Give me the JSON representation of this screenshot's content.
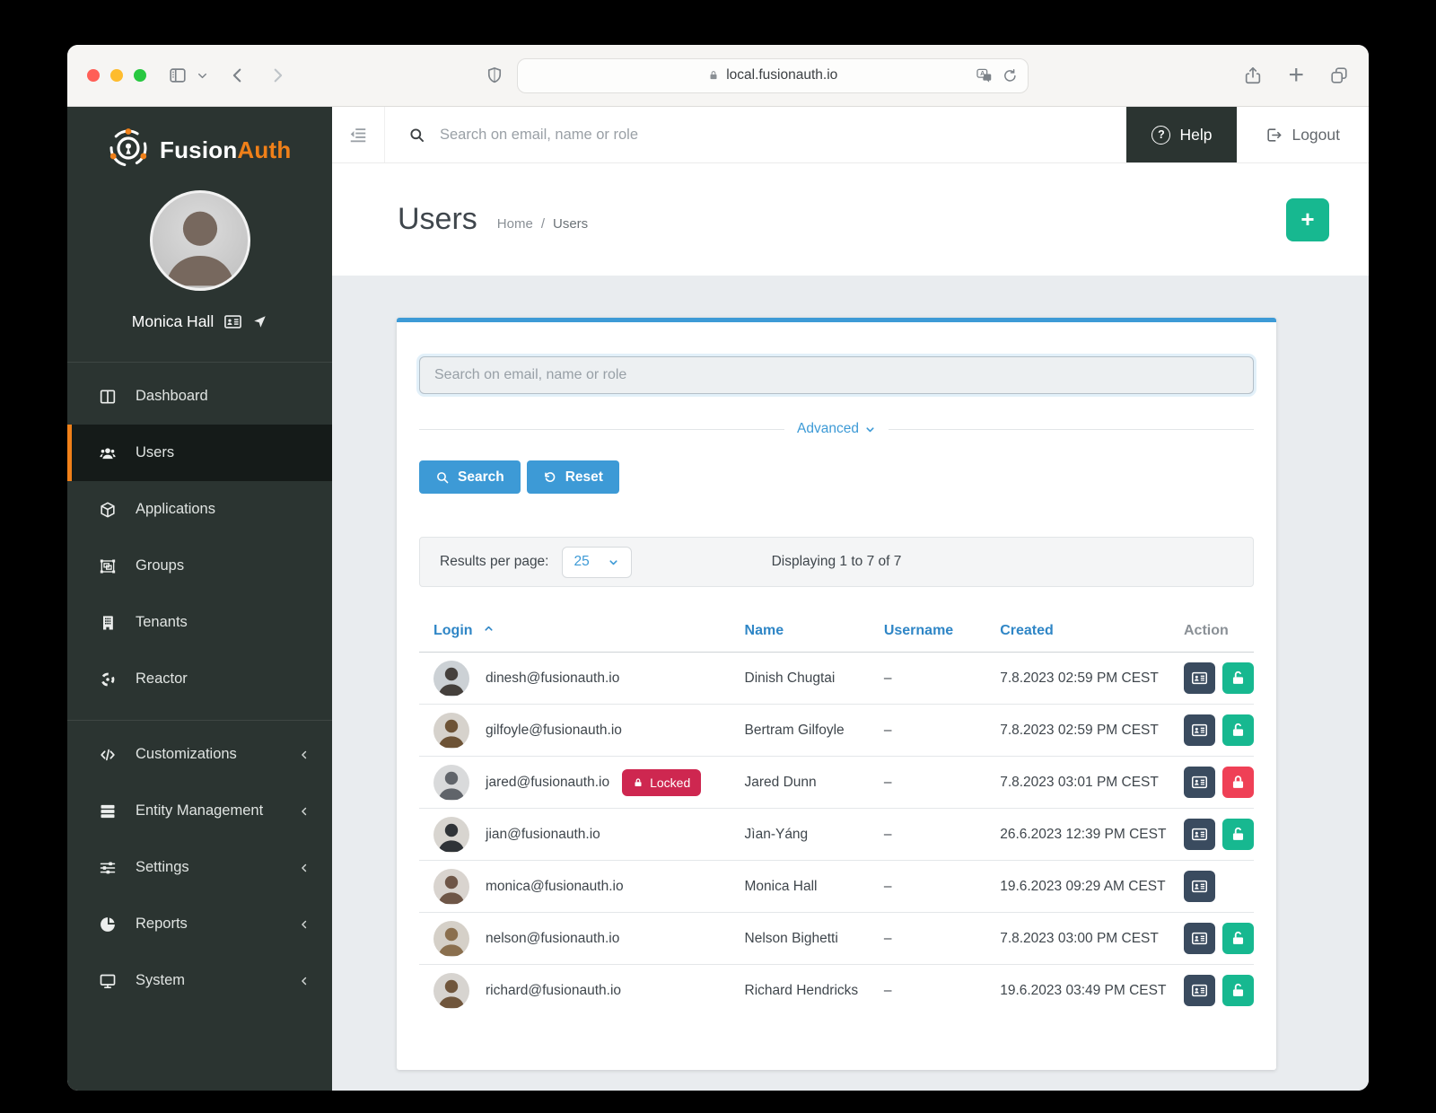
{
  "colors": {
    "blue": "#3d9ad6",
    "link_blue": "#2f86c6",
    "green": "#17b890",
    "orange": "#f08019",
    "red": "#ef4056",
    "badge_red": "#ce2750",
    "dark_action": "#3a4b5f",
    "side_bg": "#2b3431"
  },
  "browser": {
    "url": "local.fusionauth.io"
  },
  "sidebar": {
    "brand": {
      "name_primary": "Fusion",
      "name_secondary": "Auth"
    },
    "user": {
      "name": "Monica Hall"
    },
    "groups": [
      {
        "items": [
          {
            "label": "Dashboard",
            "icon": "columns-icon",
            "active": false,
            "expandable": false
          },
          {
            "label": "Users",
            "icon": "users-icon",
            "active": true,
            "expandable": false
          },
          {
            "label": "Applications",
            "icon": "cube-icon",
            "active": false,
            "expandable": false
          },
          {
            "label": "Groups",
            "icon": "object-group-icon",
            "active": false,
            "expandable": false
          },
          {
            "label": "Tenants",
            "icon": "building-icon",
            "active": false,
            "expandable": false
          },
          {
            "label": "Reactor",
            "icon": "radiation-icon",
            "active": false,
            "expandable": false
          }
        ]
      },
      {
        "items": [
          {
            "label": "Customizations",
            "icon": "code-icon",
            "active": false,
            "expandable": true
          },
          {
            "label": "Entity Management",
            "icon": "rows-icon",
            "active": false,
            "expandable": true
          },
          {
            "label": "Settings",
            "icon": "sliders-icon",
            "active": false,
            "expandable": true
          },
          {
            "label": "Reports",
            "icon": "pie-chart-icon",
            "active": false,
            "expandable": true
          },
          {
            "label": "System",
            "icon": "display-icon",
            "active": false,
            "expandable": true
          }
        ]
      }
    ]
  },
  "topbar": {
    "search_placeholder": "Search on email, name or role",
    "help_label": "Help",
    "logout_label": "Logout"
  },
  "page": {
    "title": "Users",
    "breadcrumb": [
      "Home",
      "Users"
    ]
  },
  "panel": {
    "search_placeholder": "Search on email, name or role",
    "advanced_label": "Advanced",
    "search_button": "Search",
    "reset_button": "Reset",
    "results_per_page_label": "Results per page:",
    "results_per_page_value": "25",
    "displaying_text": "Displaying 1 to 7 of 7"
  },
  "table": {
    "columns": {
      "login": "Login",
      "name": "Name",
      "username": "Username",
      "created": "Created",
      "action": "Action"
    },
    "sort_column": "Login",
    "sort_direction": "asc",
    "locked_badge_label": "Locked",
    "rows": [
      {
        "login": "dinesh@fusionauth.io",
        "name": "Dinish Chugtai",
        "username": "–",
        "created": "7.8.2023 02:59 PM CEST",
        "locked": false,
        "actions": [
          "manage",
          "unlock"
        ],
        "avatar_bg": "#ccd1d5",
        "avatar_fg": "#45403c"
      },
      {
        "login": "gilfoyle@fusionauth.io",
        "name": "Bertram Gilfoyle",
        "username": "–",
        "created": "7.8.2023 02:59 PM CEST",
        "locked": false,
        "actions": [
          "manage",
          "unlock"
        ],
        "avatar_bg": "#d6d2cc",
        "avatar_fg": "#6d5336"
      },
      {
        "login": "jared@fusionauth.io",
        "name": "Jared Dunn",
        "username": "–",
        "created": "7.8.2023 03:01 PM CEST",
        "locked": true,
        "actions": [
          "manage",
          "lock"
        ],
        "avatar_bg": "#d9dadb",
        "avatar_fg": "#60646a"
      },
      {
        "login": "jian@fusionauth.io",
        "name": "Jìan-Yáng",
        "username": "–",
        "created": "26.6.2023 12:39 PM CEST",
        "locked": false,
        "actions": [
          "manage",
          "unlock"
        ],
        "avatar_bg": "#d8d5d0",
        "avatar_fg": "#2f3337"
      },
      {
        "login": "monica@fusionauth.io",
        "name": "Monica Hall",
        "username": "–",
        "created": "19.6.2023 09:29 AM CEST",
        "locked": false,
        "actions": [
          "manage"
        ],
        "avatar_bg": "#d9d4cf",
        "avatar_fg": "#6e5647"
      },
      {
        "login": "nelson@fusionauth.io",
        "name": "Nelson Bighetti",
        "username": "–",
        "created": "7.8.2023 03:00 PM CEST",
        "locked": false,
        "actions": [
          "manage",
          "unlock"
        ],
        "avatar_bg": "#d5d0c8",
        "avatar_fg": "#8a6f4e"
      },
      {
        "login": "richard@fusionauth.io",
        "name": "Richard Hendricks",
        "username": "–",
        "created": "19.6.2023 03:49 PM CEST",
        "locked": false,
        "actions": [
          "manage",
          "unlock"
        ],
        "avatar_bg": "#d7d4d0",
        "avatar_fg": "#70563c"
      }
    ]
  }
}
